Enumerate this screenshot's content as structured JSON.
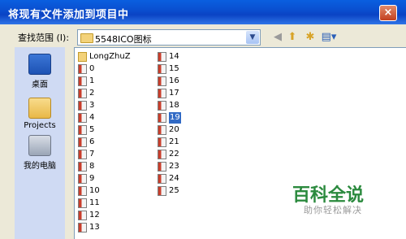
{
  "window": {
    "title": "将现有文件添加到项目中",
    "close_label": "×"
  },
  "lookin": {
    "label": "查找范围 (I):",
    "value": "5548ICO图标"
  },
  "toolbar": {
    "back_glyph": "◀",
    "up_glyph": "⬆",
    "new_folder_glyph": "✱",
    "view_glyph": "▤▾"
  },
  "places": [
    {
      "label": "桌面",
      "icon": "desktop-icon"
    },
    {
      "label": "Projects",
      "icon": "folder-icon"
    },
    {
      "label": "我的电脑",
      "icon": "computer-icon"
    }
  ],
  "files_col1": [
    "LongZhuZ",
    "0",
    "1",
    "2",
    "3",
    "4",
    "5",
    "6",
    "7",
    "8",
    "9",
    "10",
    "11",
    "12",
    "13"
  ],
  "files_col2": [
    "14",
    "15",
    "16",
    "17",
    "18",
    "19",
    "20",
    "21",
    "22",
    "23",
    "24",
    "25"
  ],
  "selected": "19",
  "watermark": {
    "brand": "百科全说",
    "slogan": "助你轻松解决"
  }
}
